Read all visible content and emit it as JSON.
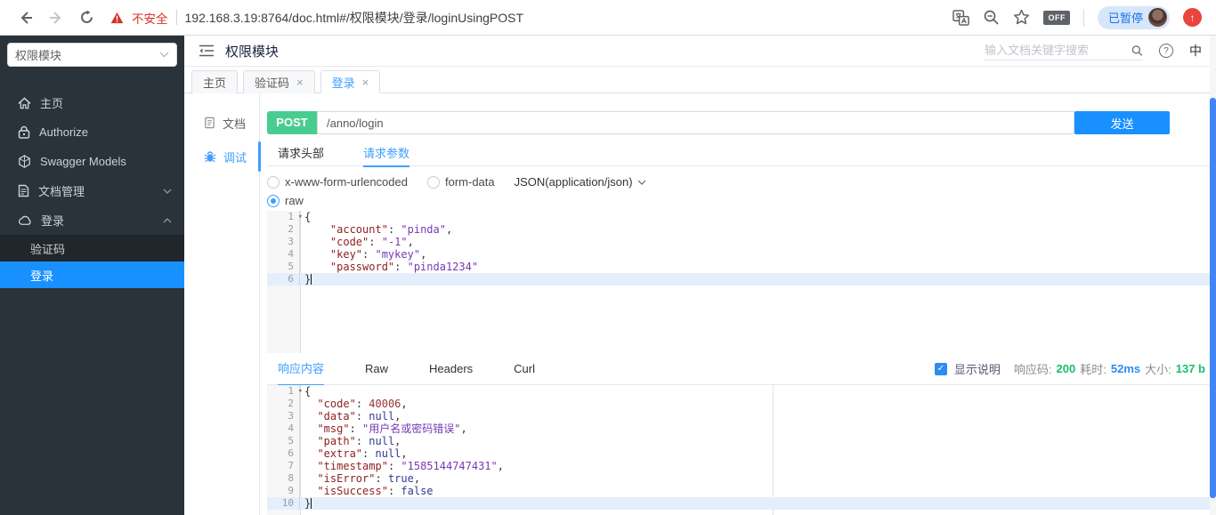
{
  "browser": {
    "security_warning": "不安全",
    "url": "192.168.3.19:8764/doc.html#/权限模块/登录/loginUsingPOST",
    "off_badge": "OFF",
    "paused_button": "已暂停",
    "update_arrow": "↑"
  },
  "sidebar": {
    "module_select": "权限模块",
    "items": [
      {
        "label": "主页",
        "icon": "home-icon"
      },
      {
        "label": "Authorize",
        "icon": "lock-icon"
      },
      {
        "label": "Swagger Models",
        "icon": "models-icon"
      },
      {
        "label": "文档管理",
        "icon": "document-manage-icon",
        "chevron": "down"
      },
      {
        "label": "登录",
        "icon": "cloud-icon",
        "chevron": "up",
        "expanded": true
      }
    ],
    "submenu": [
      {
        "label": "验证码",
        "selected": false
      },
      {
        "label": "登录",
        "selected": true
      }
    ]
  },
  "header": {
    "title": "权限模块",
    "search_placeholder": "输入文档关键字搜索",
    "help": "?",
    "lang_toggle": "中"
  },
  "tabs": {
    "items": [
      {
        "label": "主页",
        "closable": false,
        "active": false
      },
      {
        "label": "验证码",
        "closable": true,
        "active": false
      },
      {
        "label": "登录",
        "closable": true,
        "active": true
      }
    ],
    "close_glyph": "×"
  },
  "doc_nav": {
    "doc_label": "文档",
    "debug_label": "调试"
  },
  "request": {
    "method": "POST",
    "path": "/anno/login",
    "send_label": "发送",
    "tab_headers": "请求头部",
    "tab_params": "请求参数",
    "type_urlencoded": "x-www-form-urlencoded",
    "type_formdata": "form-data",
    "json_type_label": "JSON(application/json)",
    "raw_label": "raw",
    "editor": {
      "lines": [
        {
          "num": 1,
          "fold": true,
          "tokens": [
            [
              "{",
              "p"
            ]
          ]
        },
        {
          "num": 2,
          "tokens": [
            [
              "    ",
              "p"
            ],
            [
              "\"account\"",
              "k"
            ],
            [
              ": ",
              "p"
            ],
            [
              "\"pinda\"",
              "s"
            ],
            [
              ",",
              "p"
            ]
          ]
        },
        {
          "num": 3,
          "tokens": [
            [
              "    ",
              "p"
            ],
            [
              "\"code\"",
              "k"
            ],
            [
              ": ",
              "p"
            ],
            [
              "\"-1\"",
              "s"
            ],
            [
              ",",
              "p"
            ]
          ]
        },
        {
          "num": 4,
          "tokens": [
            [
              "    ",
              "p"
            ],
            [
              "\"key\"",
              "k"
            ],
            [
              ": ",
              "p"
            ],
            [
              "\"mykey\"",
              "s"
            ],
            [
              ",",
              "p"
            ]
          ]
        },
        {
          "num": 5,
          "tokens": [
            [
              "    ",
              "p"
            ],
            [
              "\"password\"",
              "k"
            ],
            [
              ": ",
              "p"
            ],
            [
              "\"pinda1234\"",
              "s"
            ]
          ]
        },
        {
          "num": 6,
          "active": true,
          "cursor": true,
          "tokens": [
            [
              "}",
              "p"
            ]
          ]
        }
      ]
    }
  },
  "response": {
    "tab_content": "响应内容",
    "tab_raw": "Raw",
    "tab_headers": "Headers",
    "tab_curl": "Curl",
    "show_desc_label": "显示说明",
    "show_desc_checked": true,
    "status_label": "响应码:",
    "status_value": "200",
    "time_label": "耗时:",
    "time_value": "52ms",
    "size_label": "大小:",
    "size_value": "137 b",
    "editor": {
      "lines": [
        {
          "num": 1,
          "fold": true,
          "tokens": [
            [
              "{",
              "p"
            ]
          ]
        },
        {
          "num": 2,
          "tokens": [
            [
              "  ",
              "p"
            ],
            [
              "\"code\"",
              "k"
            ],
            [
              ": ",
              "p"
            ],
            [
              "40006",
              "n"
            ],
            [
              ",",
              "p"
            ]
          ]
        },
        {
          "num": 3,
          "tokens": [
            [
              "  ",
              "p"
            ],
            [
              "\"data\"",
              "k"
            ],
            [
              ": ",
              "p"
            ],
            [
              "null",
              "a"
            ],
            [
              ",",
              "p"
            ]
          ]
        },
        {
          "num": 4,
          "tokens": [
            [
              "  ",
              "p"
            ],
            [
              "\"msg\"",
              "k"
            ],
            [
              ": ",
              "p"
            ],
            [
              "\"用户名或密码错误\"",
              "s"
            ],
            [
              ",",
              "p"
            ]
          ]
        },
        {
          "num": 5,
          "tokens": [
            [
              "  ",
              "p"
            ],
            [
              "\"path\"",
              "k"
            ],
            [
              ": ",
              "p"
            ],
            [
              "null",
              "a"
            ],
            [
              ",",
              "p"
            ]
          ]
        },
        {
          "num": 6,
          "tokens": [
            [
              "  ",
              "p"
            ],
            [
              "\"extra\"",
              "k"
            ],
            [
              ": ",
              "p"
            ],
            [
              "null",
              "a"
            ],
            [
              ",",
              "p"
            ]
          ]
        },
        {
          "num": 7,
          "tokens": [
            [
              "  ",
              "p"
            ],
            [
              "\"timestamp\"",
              "k"
            ],
            [
              ": ",
              "p"
            ],
            [
              "\"1585144747431\"",
              "s"
            ],
            [
              ",",
              "p"
            ]
          ]
        },
        {
          "num": 8,
          "tokens": [
            [
              "  ",
              "p"
            ],
            [
              "\"isError\"",
              "k"
            ],
            [
              ": ",
              "p"
            ],
            [
              "true",
              "a"
            ],
            [
              ",",
              "p"
            ]
          ]
        },
        {
          "num": 9,
          "tokens": [
            [
              "  ",
              "p"
            ],
            [
              "\"isSuccess\"",
              "k"
            ],
            [
              ": ",
              "p"
            ],
            [
              "false",
              "a"
            ]
          ]
        },
        {
          "num": 10,
          "active": true,
          "cursor": true,
          "tokens": [
            [
              "}",
              "p"
            ]
          ]
        }
      ]
    }
  },
  "colors": {
    "accent_blue": "#1890ff",
    "tab_active_blue": "#409eff",
    "post_green": "#49cc90",
    "status_green": "#19be6b",
    "time_blue": "#2d8cf0",
    "danger_red": "#d93025",
    "sidebar_dark": "#2a323a",
    "scrollbar_blue": "#4285f4"
  }
}
